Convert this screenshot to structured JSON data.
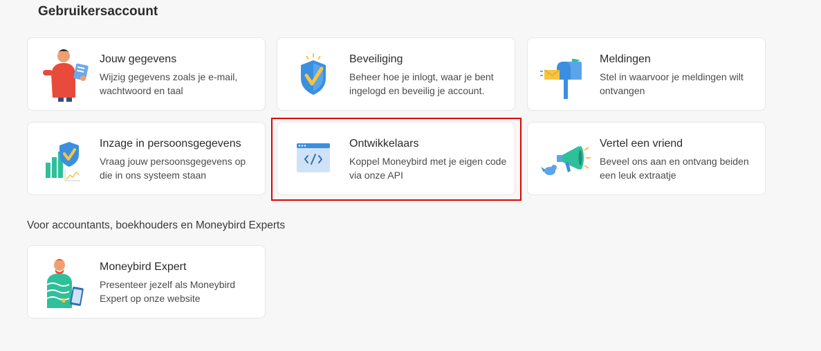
{
  "section": {
    "title": "Gebruikersaccount"
  },
  "cards": [
    {
      "title": "Jouw gegevens",
      "description": "Wijzig gegevens zoals je e-mail, wachtwoord en taal",
      "icon": "person-profile-icon"
    },
    {
      "title": "Beveiliging",
      "description": "Beheer hoe je inlogt, waar je bent ingelogd en beveilig je account.",
      "icon": "shield-check-icon"
    },
    {
      "title": "Meldingen",
      "description": "Stel in waarvoor je meldingen wilt ontvangen",
      "icon": "mailbox-icon"
    },
    {
      "title": "Inzage in persoonsgegevens",
      "description": "Vraag jouw persoonsgegevens op die in ons systeem staan",
      "icon": "data-chart-shield-icon"
    },
    {
      "title": "Ontwikkelaars",
      "description": "Koppel Moneybird met je eigen code via onze API",
      "icon": "code-window-icon"
    },
    {
      "title": "Vertel een vriend",
      "description": "Beveel ons aan en ontvang beiden een leuk extraatje",
      "icon": "megaphone-bird-icon"
    }
  ],
  "experts_section": {
    "title": "Voor accountants, boekhouders en Moneybird Experts"
  },
  "expert_card": {
    "title": "Moneybird Expert",
    "description": "Presenteer jezelf als Moneybird Expert op onze website",
    "icon": "expert-person-tablet-icon"
  },
  "colors": {
    "highlight": "#e00000",
    "card_bg": "#ffffff",
    "page_bg": "#f7f7f8",
    "accent_blue": "#3b8fe0",
    "accent_yellow": "#f5c542",
    "accent_green": "#2fbf9a"
  }
}
